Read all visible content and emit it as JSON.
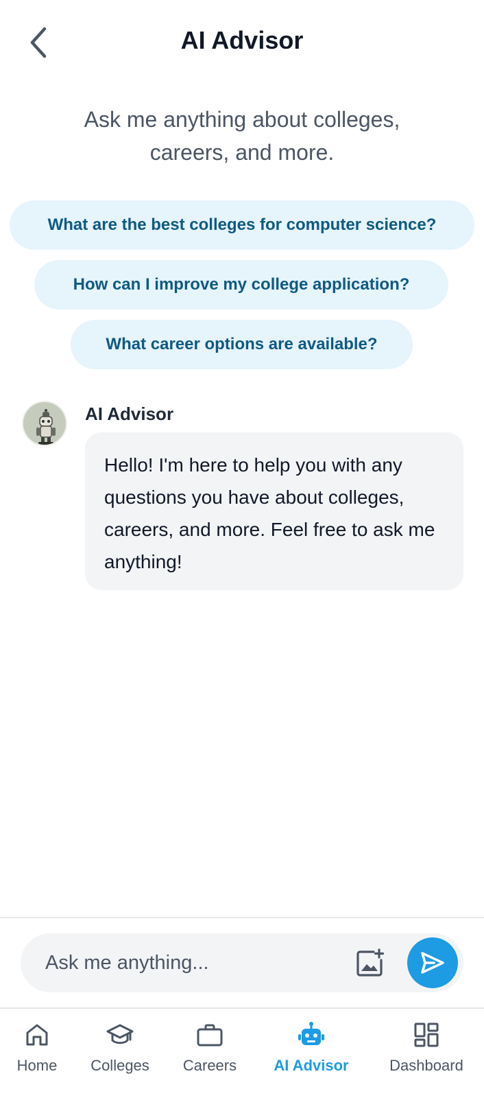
{
  "header": {
    "title": "AI Advisor",
    "back_icon": "chevron-left-icon"
  },
  "intro": {
    "line1": "Ask me anything about colleges,",
    "line2": "careers, and more."
  },
  "suggestions": [
    "What are the best colleges for computer science?",
    "How can I improve my college application?",
    "What career options are available?"
  ],
  "message": {
    "sender": "AI Advisor",
    "avatar_icon": "robot-avatar",
    "text": "Hello! I'm here to help you with any questions you have about colleges, careers, and more. Feel free to ask me anything!"
  },
  "input": {
    "placeholder": "Ask me anything...",
    "image_icon": "add-image-icon",
    "send_icon": "send-icon"
  },
  "nav": {
    "items": [
      {
        "label": "Home",
        "icon": "home-icon"
      },
      {
        "label": "Colleges",
        "icon": "graduation-cap-icon"
      },
      {
        "label": "Careers",
        "icon": "briefcase-icon"
      },
      {
        "label": "AI Advisor",
        "icon": "robot-icon",
        "active": true
      },
      {
        "label": "Dashboard",
        "icon": "dashboard-icon"
      }
    ]
  },
  "colors": {
    "accent": "#1d9be3",
    "chip_bg": "#e6f4fc",
    "chip_text": "#0f5a82",
    "bubble_bg": "#f3f4f6"
  }
}
